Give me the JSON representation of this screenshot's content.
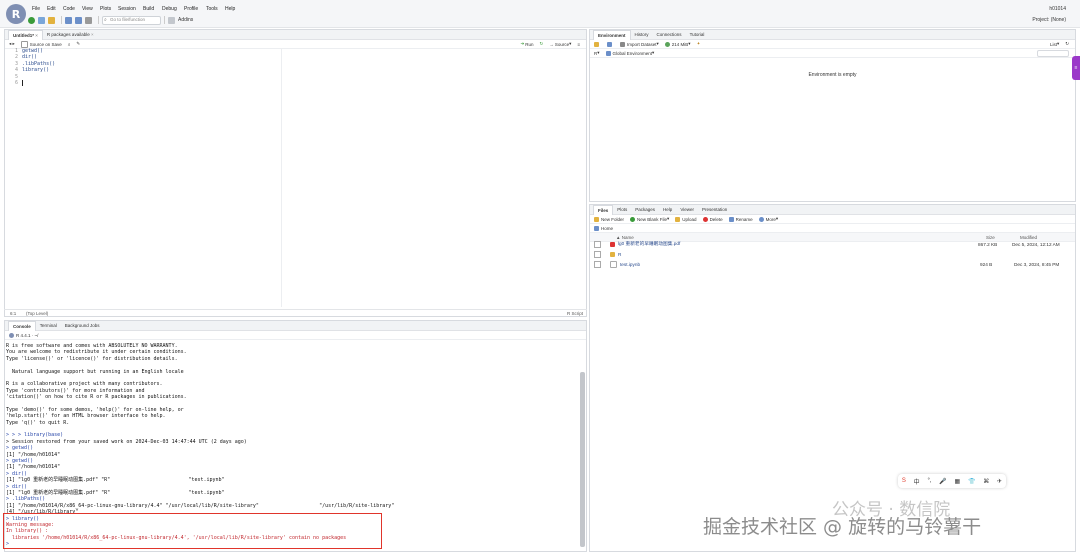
{
  "menubar": {
    "items": [
      "File",
      "Edit",
      "Code",
      "View",
      "Plots",
      "Session",
      "Build",
      "Debug",
      "Profile",
      "Tools",
      "Help"
    ],
    "user": "h01014",
    "goto_placeholder": "Go to file/function",
    "addins": "Addins",
    "project": "Project: (None)"
  },
  "editor": {
    "tabs": [
      "Untitled1*",
      "R packages available"
    ],
    "toolbar": {
      "source_on_save": "Source on Save",
      "run": "Run",
      "source": "Source"
    },
    "line_numbers": [
      "1",
      "2",
      "3",
      "4",
      "5",
      "6"
    ],
    "code": [
      "getwd()",
      "dir()",
      ".libPaths()",
      "library()",
      "",
      ""
    ],
    "status_pos": "6:1",
    "status_scope": "(Top Level)",
    "status_type": "R Script"
  },
  "console": {
    "tabs": [
      "Console",
      "Terminal",
      "Background Jobs"
    ],
    "version": "R 4.4.1 · ~/",
    "lines": [
      {
        "t": "R is free software and comes with ABSOLUTELY NO WARRANTY.",
        "c": ""
      },
      {
        "t": "You are welcome to redistribute it under certain conditions.",
        "c": ""
      },
      {
        "t": "Type 'license()' or 'licence()' for distribution details.",
        "c": ""
      },
      {
        "t": "",
        "c": ""
      },
      {
        "t": "  Natural language support but running in an English locale",
        "c": ""
      },
      {
        "t": "",
        "c": ""
      },
      {
        "t": "R is a collaborative project with many contributors.",
        "c": ""
      },
      {
        "t": "Type 'contributors()' for more information and",
        "c": ""
      },
      {
        "t": "'citation()' on how to cite R or R packages in publications.",
        "c": ""
      },
      {
        "t": "",
        "c": ""
      },
      {
        "t": "Type 'demo()' for some demos, 'help()' for on-line help, or",
        "c": ""
      },
      {
        "t": "'help.start()' for an HTML browser interface to help.",
        "c": ""
      },
      {
        "t": "Type 'q()' to quit R.",
        "c": ""
      },
      {
        "t": "",
        "c": ""
      },
      {
        "t": "> > > library(base)",
        "c": "p"
      },
      {
        "t": "> Session restored from your saved work on 2024-Dec-03 14:47:44 UTC (2 days ago)",
        "c": ""
      },
      {
        "t": "> getwd()",
        "c": "p"
      },
      {
        "t": "[1] \"/home/h01014\"",
        "c": ""
      },
      {
        "t": "> getwd()",
        "c": "p"
      },
      {
        "t": "[1] \"/home/h01014\"",
        "c": ""
      },
      {
        "t": "> dir()",
        "c": "p"
      },
      {
        "t": "[1] \"lg0 重新老的早睡眠动图集.pdf\" \"R\"                          \"test.ipynb\"",
        "c": ""
      },
      {
        "t": "> dir()",
        "c": "p"
      },
      {
        "t": "[1] \"lg0 重新老的早睡眠动图集.pdf\" \"R\"                          \"test.ipynb\"",
        "c": ""
      },
      {
        "t": "> .libPaths()",
        "c": "p"
      },
      {
        "t": "[1] \"/home/h01014/R/x86_64-pc-linux-gnu-library/4.4\" \"/usr/local/lib/R/site-library\"                    \"/usr/lib/R/site-library\"",
        "c": ""
      },
      {
        "t": "[4] \"/usr/lib/R/library\"",
        "c": ""
      },
      {
        "t": "> library()",
        "c": "p"
      },
      {
        "t": "Warning message:",
        "c": "r"
      },
      {
        "t": "In library() :",
        "c": "r"
      },
      {
        "t": "  libraries '/home/h01014/R/x86_64-pc-linux-gnu-library/4.4', '/usr/local/lib/R/site-library' contain no packages",
        "c": "r"
      },
      {
        "t": ">",
        "c": "p"
      }
    ]
  },
  "environment": {
    "tabs": [
      "Environment",
      "History",
      "Connections",
      "Tutorial"
    ],
    "import": "Import Dataset",
    "memory": "214 MiB",
    "view": "List",
    "lang": "R",
    "scope": "Global Environment",
    "empty": "Environment is empty"
  },
  "files": {
    "tabs": [
      "Files",
      "Plots",
      "Packages",
      "Help",
      "Viewer",
      "Presentation"
    ],
    "toolbar": {
      "new_folder": "New Folder",
      "new_blank": "New Blank File",
      "upload": "Upload",
      "delete": "Delete",
      "rename": "Rename",
      "more": "More"
    },
    "breadcrumb": "Home",
    "headers": {
      "name": "Name",
      "size": "Size",
      "modified": "Modified"
    },
    "rows": [
      {
        "name": "lg0 重新老的早睡眠动图集.pdf",
        "size": "867.2 KB",
        "modified": "Dec 5, 2024, 12:12 AM"
      },
      {
        "name": "R",
        "size": "",
        "modified": ""
      },
      {
        "name": "test.ipynb",
        "size": "924 B",
        "modified": "Dec 3, 2024, 8:45 PM"
      }
    ]
  },
  "overlay": {
    "ime": [
      "S",
      "中",
      "°,",
      "🎤",
      "▦",
      "👕",
      "⌘",
      "✈"
    ],
    "side": "≡",
    "wm_top": "公众号 · 数信院",
    "wm_main": "掘金技术社区 @ 旋转的马铃薯干"
  }
}
